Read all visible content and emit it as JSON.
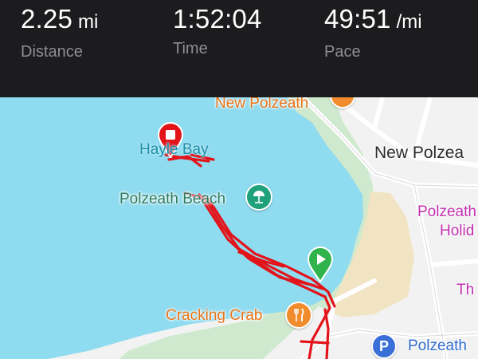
{
  "stats": {
    "distance": {
      "value": "2.25",
      "unit": "mi",
      "label": "Distance"
    },
    "time": {
      "value": "1:52:04",
      "unit": "",
      "label": "Time"
    },
    "pace": {
      "value": "49:51",
      "unit": "/mi",
      "label": "Pace"
    }
  },
  "map": {
    "labels": {
      "new_polzeath_top": "New Polzeath",
      "new_polzeath_town": "New Polzea",
      "hayle_bay": "Hayle Bay",
      "polzeath_beach": "Polzeath Beach",
      "polzeath_holiday_line1": "Polzeath",
      "polzeath_holiday_line2": "Holid",
      "th_fragment": "Th",
      "cracking_crab": "Cracking Crab",
      "polzeath_parking": "Polzeath"
    },
    "icons": {
      "start": "play-icon",
      "end": "stop-icon",
      "beach": "umbrella-icon",
      "restaurant": "fork-knife-icon",
      "parking": "parking-icon",
      "parking_letter": "P"
    },
    "colors": {
      "sea": "#8fdbef",
      "land": "#f2f2f2",
      "sand": "#f1e4c2",
      "green": "#cfe9cf",
      "track": "#e3131a",
      "start_pin": "#2fb34a",
      "end_pin": "#e3131a",
      "poi_orange": "#f08c2c",
      "poi_green": "#1fa27b",
      "parking_blue": "#3a6fd8"
    }
  }
}
